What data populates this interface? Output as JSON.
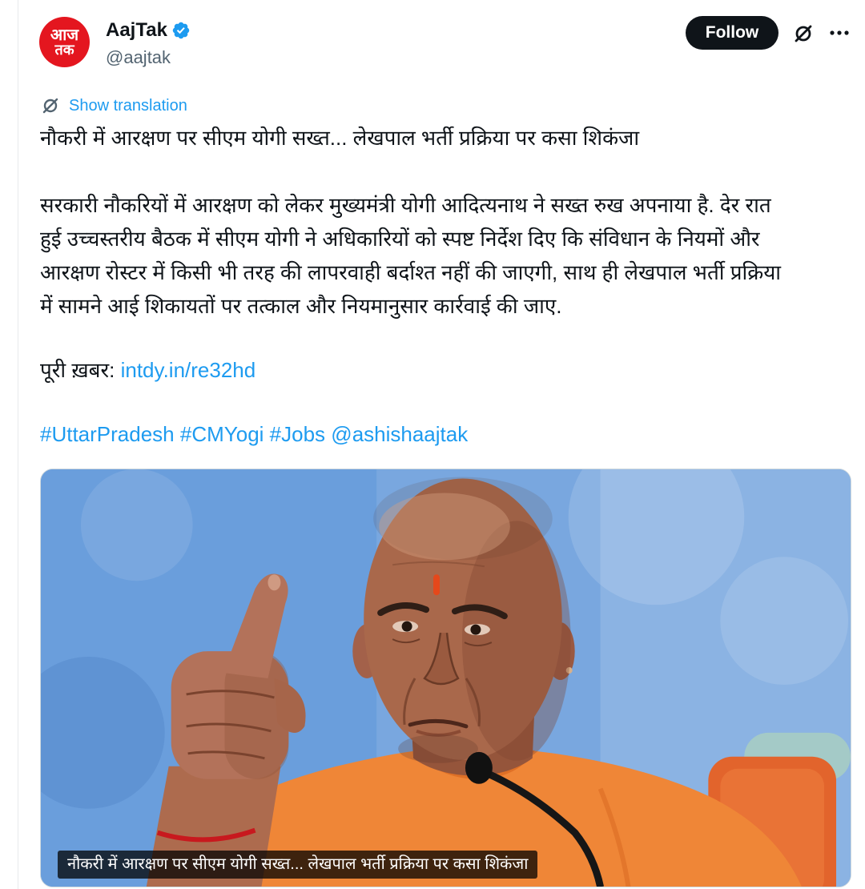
{
  "author": {
    "display_name": "AajTak",
    "handle": "@aajtak",
    "avatar_logo_top": "आज",
    "avatar_logo_bottom": "तक"
  },
  "actions": {
    "follow_label": "Follow"
  },
  "translation": {
    "label": "Show translation"
  },
  "post": {
    "headline": "नौकरी में आरक्षण पर सीएम योगी सख्त... लेखपाल भर्ती प्रक्रिया पर कसा शिकंजा",
    "body_lines": [
      "सरकारी नौकरियों में आरक्षण को लेकर मुख्यमंत्री योगी आदित्यनाथ ने सख्त रुख अपनाया है. देर रात",
      "हुई उच्चस्तरीय बैठक में सीएम योगी ने अधिकारियों को स्पष्ट निर्देश दिए कि संविधान के नियमों और",
      "आरक्षण रोस्टर में किसी भी तरह की लापरवाही बर्दाश्त नहीं की जाएगी, साथ ही लेखपाल भर्ती प्रक्रिया",
      "में सामने आई शिकायतों पर तत्काल और नियमानुसार कार्रवाई की जाए."
    ],
    "full_news_label": "पूरी ख़बर:",
    "full_news_link": "intdy.in/re32hd",
    "hashtags": [
      "#UttarPradesh",
      "#CMYogi",
      "#Jobs"
    ],
    "mention": "@ashishaajtak",
    "image_caption": "नौकरी में आरक्षण पर सीएम योगी सख्त... लेखपाल भर्ती प्रक्रिया पर कसा शिकंजा"
  },
  "icons": {
    "verified": "verified-badge-icon",
    "translate": "grok-icon",
    "grok": "grok-icon",
    "more": "more-icon"
  },
  "colors": {
    "text": "#0f1419",
    "secondary_text": "#536471",
    "link": "#1d9bf0",
    "avatar_red": "#e4161f",
    "follow_button": "#0f1419",
    "caption_background": "#000000"
  }
}
